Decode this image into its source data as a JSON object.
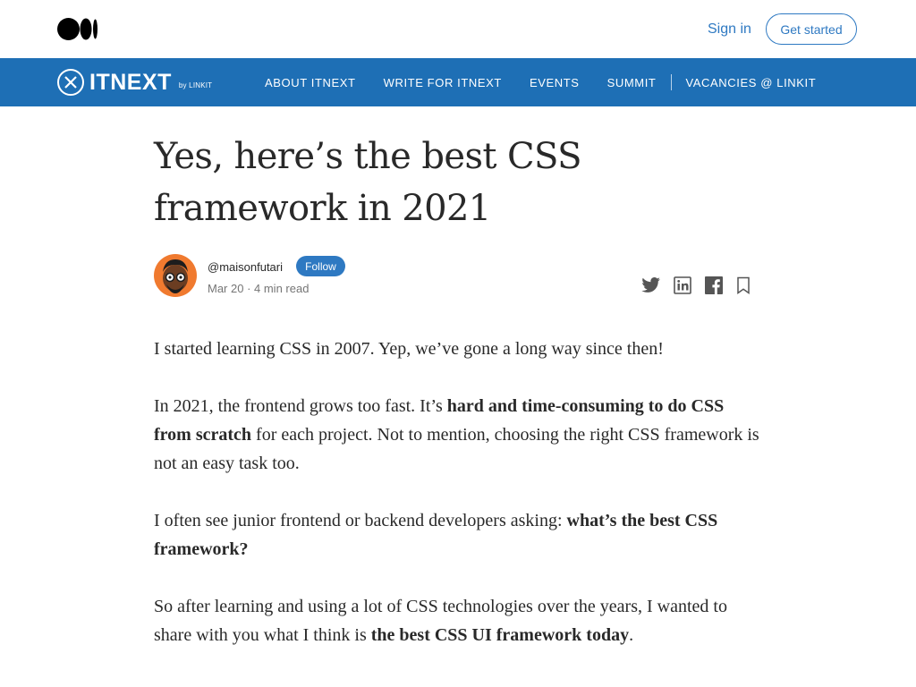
{
  "header": {
    "signin_label": "Sign in",
    "getstarted_label": "Get started"
  },
  "publication": {
    "name": "ITNEXT",
    "by": "by LINKIT",
    "nav": [
      "ABOUT ITNEXT",
      "WRITE FOR ITNEXT",
      "EVENTS",
      "SUMMIT",
      "VACANCIES @ LINKIT"
    ],
    "color": "#1e6fb5"
  },
  "article": {
    "title_line1": "Yes, here’s the best CSS",
    "title_line2": "framework in 2021",
    "author": "@maisonfutari",
    "follow_label": "Follow",
    "meta": "Mar 20 · 4 min read",
    "p1": "I started learning CSS in 2007. Yep, we’ve gone a long way since then!",
    "p2_a": "In 2021, the frontend grows too fast. It’s ",
    "p2_b": "hard and time-consuming to do CSS from scratch",
    "p2_c": " for each project. Not to mention, choosing the right CSS framework is not an easy task too.",
    "p3_a": "I often see junior frontend or backend developers asking: ",
    "p3_b": "what’s the best CSS framework?",
    "p4_a": "So after learning and using a lot of CSS technologies over the years, I wanted to share with you what I think is ",
    "p4_b": "the best CSS UI framework today",
    "p4_c": "."
  },
  "share_icons": [
    "twitter-icon",
    "linkedin-icon",
    "facebook-icon",
    "bookmark-icon"
  ],
  "accent": "#2e79c2"
}
